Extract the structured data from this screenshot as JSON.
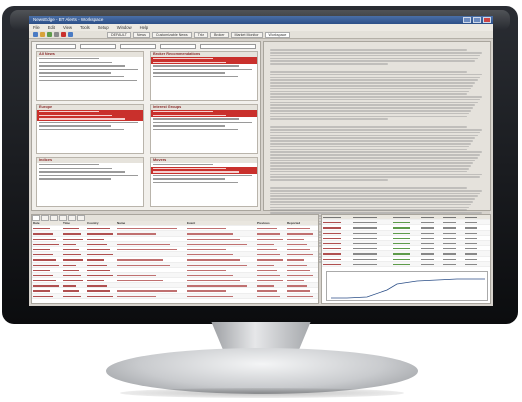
{
  "window": {
    "title": "NewsEdge - BT Alerts - Workspace"
  },
  "menu": [
    "File",
    "Edit",
    "View",
    "Tools",
    "Setup",
    "Window",
    "Help"
  ],
  "tabs": [
    "DEFAULT",
    "News",
    "Customizable News",
    "Trkr",
    "Broker",
    "Market Monitor",
    "Workspace"
  ],
  "widgets": [
    {
      "title": "All News",
      "rows": 7,
      "red_rows": []
    },
    {
      "title": "Broker Recommendations",
      "rows": 6,
      "red_rows": [
        0,
        1
      ]
    },
    {
      "title": "Europe",
      "rows": 6,
      "red_rows": [
        0,
        1,
        2
      ]
    },
    {
      "title": "Interest Groups",
      "rows": 6,
      "red_rows": [
        0,
        1
      ]
    },
    {
      "title": "Indices",
      "rows": 5,
      "red_rows": []
    },
    {
      "title": "Movers",
      "rows": 6,
      "red_rows": [
        1,
        2
      ]
    }
  ],
  "grid": {
    "headers": [
      "Date",
      "Time",
      "Country",
      "Name",
      "Event",
      "Previous",
      "Reported"
    ],
    "row_count": 26
  },
  "quote_table": {
    "row_count": 14
  },
  "colors": {
    "alert_red": "#c9302c",
    "title_blue": "#2c4f88",
    "up_green": "#5e9b4a"
  }
}
